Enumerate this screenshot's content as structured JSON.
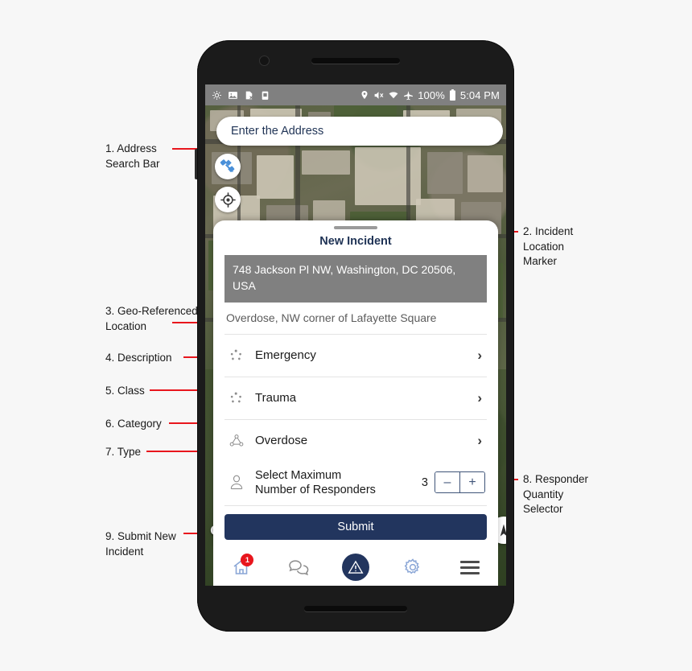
{
  "annotations": [
    {
      "id": "a1",
      "number": "1.",
      "text": "1. Address\n    Search Bar"
    },
    {
      "id": "a2",
      "number": "2.",
      "text": "2. Incident\n     Location\n     Marker"
    },
    {
      "id": "a3",
      "number": "3.",
      "text": "3. Geo-Referenced\n     Location"
    },
    {
      "id": "a4",
      "number": "4.",
      "text": "4. Description"
    },
    {
      "id": "a5",
      "number": "5.",
      "text": "5. Class"
    },
    {
      "id": "a6",
      "number": "6.",
      "text": "6. Category"
    },
    {
      "id": "a7",
      "number": "7.",
      "text": "7. Type"
    },
    {
      "id": "a8",
      "number": "8.",
      "text": "8. Responder\n     Quantity\n     Selector"
    },
    {
      "id": "a9",
      "number": "9.",
      "text": "9. Submit New\n     Incident"
    }
  ],
  "statusbar": {
    "left_icons": [
      "location-crosshair-icon",
      "image-icon",
      "sd-card-icon",
      "clipboard-icon"
    ],
    "right_icons": [
      "location-pin-icon",
      "mute-icon",
      "wifi-icon",
      "airplane-mode-icon"
    ],
    "battery_percent": "100%",
    "time": "5:04 PM"
  },
  "map": {
    "search_placeholder": "Enter the Address",
    "satellite_button": "satellite-icon",
    "gps_button": "my-location-icon",
    "marker": "incident-location-marker",
    "attribution": "G"
  },
  "sheet": {
    "title": "New Incident",
    "address": "748 Jackson Pl NW, Washington, DC 20506, USA",
    "description": "Overdose, NW corner of Lafayette Square",
    "rows": [
      {
        "label": "Emergency",
        "icon": "class-burst-icon",
        "chevron": "›"
      },
      {
        "label": "Trauma",
        "icon": "category-burst-icon",
        "chevron": "›"
      },
      {
        "label": "Overdose",
        "icon": "type-network-icon",
        "chevron": "›"
      }
    ],
    "responders": {
      "label": "Select Maximum Number of Responders",
      "count": "3",
      "decrement": "–",
      "increment": "+"
    },
    "submit_label": "Submit"
  },
  "bottomnav": {
    "items": [
      {
        "name": "home",
        "badge": "1"
      },
      {
        "name": "messages",
        "badge": ""
      },
      {
        "name": "alerts",
        "badge": ""
      },
      {
        "name": "settings",
        "badge": ""
      },
      {
        "name": "menu",
        "badge": ""
      }
    ]
  },
  "colors": {
    "navy": "#22355e",
    "red": "#e8161d",
    "gray_box": "#808080",
    "light_blue": "#8aa6d6"
  }
}
